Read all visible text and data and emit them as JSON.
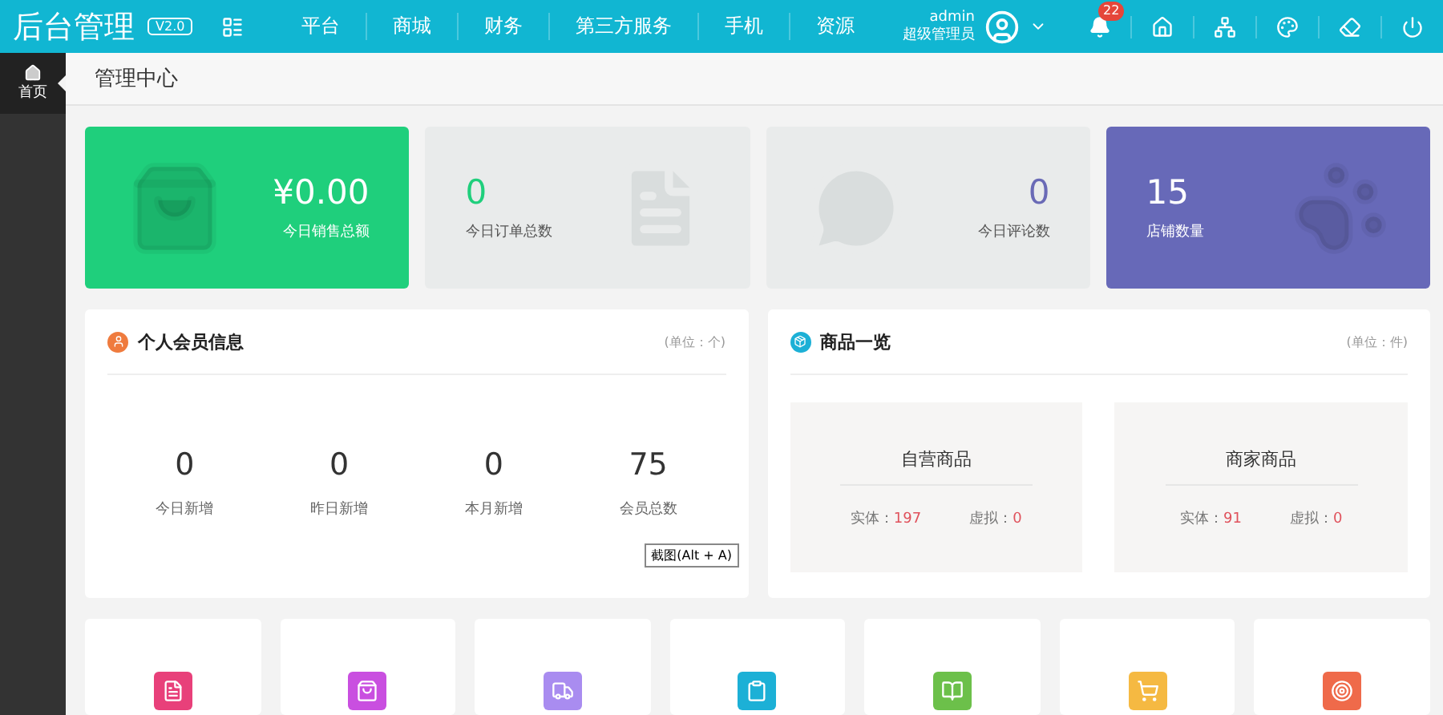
{
  "header": {
    "title": "后台管理",
    "version": "V2.0",
    "nav": [
      {
        "label": "平台"
      },
      {
        "label": "商城"
      },
      {
        "label": "财务"
      },
      {
        "label": "第三方服务"
      },
      {
        "label": "手机"
      },
      {
        "label": "资源"
      }
    ],
    "user": {
      "name": "admin",
      "role": "超级管理员"
    },
    "notifications": "22",
    "tools": [
      {
        "kind": "home"
      },
      {
        "kind": "sitemap"
      },
      {
        "kind": "palette"
      },
      {
        "kind": "clean"
      },
      {
        "kind": "power"
      }
    ]
  },
  "sidebar": {
    "items": [
      {
        "label": "首页",
        "selected": true
      }
    ]
  },
  "breadcrumb": "管理中心",
  "stats": [
    {
      "kind": "solid",
      "color": "#1fcf7c",
      "value": "¥0.00",
      "label": "今日销售总额"
    },
    {
      "kind": "light",
      "color": "#1fcf7c",
      "value": "0",
      "label": "今日订单总数"
    },
    {
      "kind": "light",
      "color": "#6a6ab6",
      "value": "0",
      "label": "今日评论数"
    },
    {
      "kind": "solid",
      "color": "#6769b8",
      "value": "15",
      "label": "店铺数量"
    }
  ],
  "members": {
    "title": "个人会员信息",
    "unit": "(单位：个)",
    "items": [
      {
        "value": "0",
        "label": "今日新增"
      },
      {
        "value": "0",
        "label": "昨日新增"
      },
      {
        "value": "0",
        "label": "本月新增"
      },
      {
        "value": "75",
        "label": "会员总数"
      }
    ]
  },
  "tooltip": "截图(Alt + A)",
  "goods": {
    "title": "商品一览",
    "unit": "(单位：件)",
    "groups": [
      {
        "title": "自营商品",
        "stats": [
          {
            "label": "实体：",
            "value": "197"
          },
          {
            "label": "虚拟：",
            "value": "0"
          }
        ]
      },
      {
        "title": "商家商品",
        "stats": [
          {
            "label": "实体：",
            "value": "91"
          },
          {
            "label": "虚拟：",
            "value": "0"
          }
        ]
      }
    ]
  },
  "shortcuts": [
    {
      "color": "#e8407a"
    },
    {
      "color": "#c94fe0"
    },
    {
      "color": "#a98cf0"
    },
    {
      "color": "#1cb0d6"
    },
    {
      "color": "#6cc04a"
    },
    {
      "color": "#f5b942"
    },
    {
      "color": "#ef6a4a"
    }
  ]
}
